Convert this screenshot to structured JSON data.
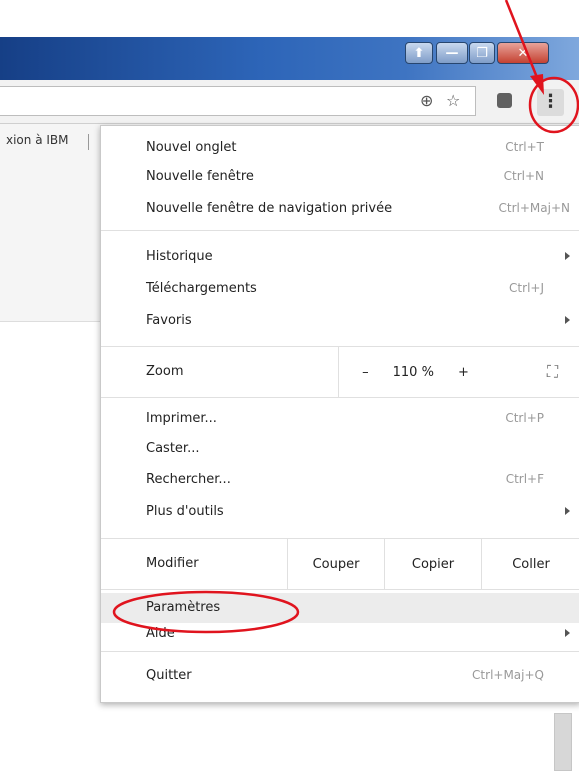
{
  "window": {
    "buttons": {
      "user": "⬆",
      "minimize": "—",
      "maximize": "❐",
      "close": "✕"
    }
  },
  "toolbar": {
    "zoom_icon": "⊕",
    "star_icon": "☆",
    "menu_icon": "⋮"
  },
  "bookmarks": {
    "item": "xion à IBM"
  },
  "menu": {
    "new_tab": {
      "label": "Nouvel onglet",
      "shortcut": "Ctrl+T"
    },
    "new_window": {
      "label": "Nouvelle fenêtre",
      "shortcut": "Ctrl+N"
    },
    "incognito": {
      "label": "Nouvelle fenêtre de navigation privée",
      "shortcut": "Ctrl+Maj+N"
    },
    "history": {
      "label": "Historique"
    },
    "downloads": {
      "label": "Téléchargements",
      "shortcut": "Ctrl+J"
    },
    "bookmarks": {
      "label": "Favoris"
    },
    "zoom": {
      "label": "Zoom",
      "minus": "–",
      "value": "110 %",
      "plus": "+",
      "fullscreen": "⛶"
    },
    "print": {
      "label": "Imprimer...",
      "shortcut": "Ctrl+P"
    },
    "cast": {
      "label": "Caster..."
    },
    "find": {
      "label": "Rechercher...",
      "shortcut": "Ctrl+F"
    },
    "more_tools": {
      "label": "Plus d'outils"
    },
    "edit": {
      "label": "Modifier",
      "cut": "Couper",
      "copy": "Copier",
      "paste": "Coller"
    },
    "settings": {
      "label": "Paramètres"
    },
    "help": {
      "label": "Aide"
    },
    "quit": {
      "label": "Quitter",
      "shortcut": "Ctrl+Maj+Q"
    }
  },
  "colors": {
    "annotation": "#e0141e",
    "highlight": "#ececec"
  }
}
